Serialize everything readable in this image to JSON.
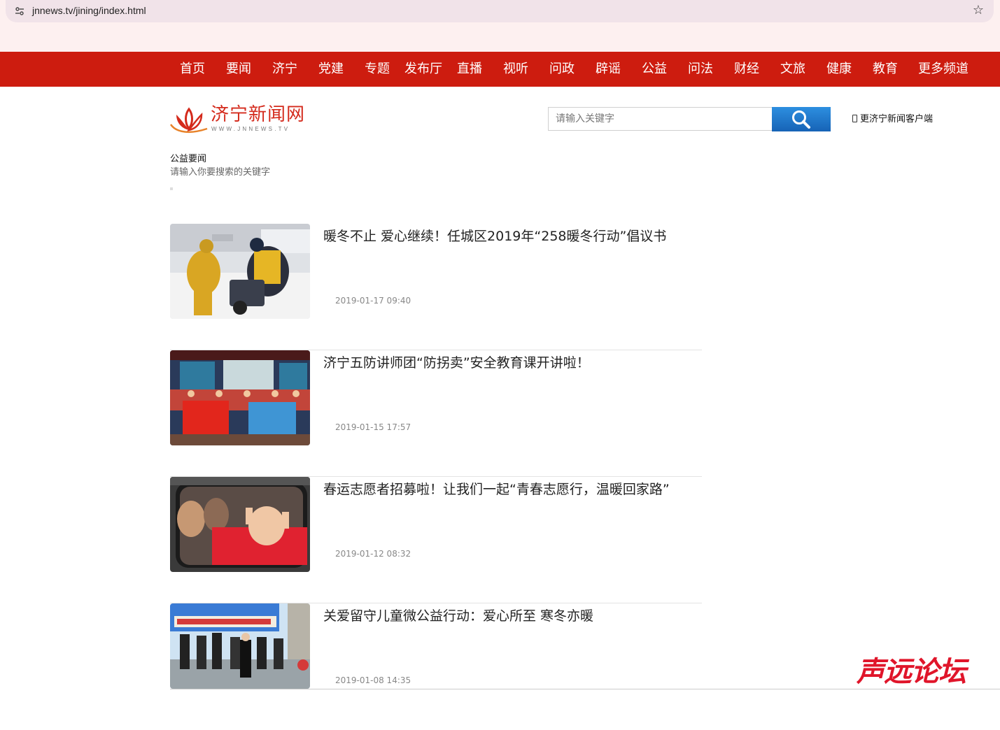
{
  "browser": {
    "url": "jnnews.tv/jining/index.html"
  },
  "nav": {
    "items": [
      "首页",
      "要闻",
      "济宁",
      "党建",
      "专题",
      "发布厅",
      "直播",
      "视听",
      "问政",
      "辟谣",
      "公益",
      "问法",
      "财经",
      "文旅",
      "健康",
      "教育",
      "更多频道"
    ]
  },
  "header": {
    "logo_text": "济宁新闻网",
    "logo_url": "WWW.JNNEWS.TV",
    "search_placeholder": "请输入关键字",
    "client_link": "更济宁新闻客户端"
  },
  "section": {
    "title": "公益要闻",
    "subtitle": "请输入你要搜索的关键字"
  },
  "news": [
    {
      "title": "暖冬不止 爱心继续！任城区2019年“258暖冬行动”倡议书",
      "date": "2019-01-17 09:40"
    },
    {
      "title": "济宁五防讲师团“防拐卖”安全教育课开讲啦！",
      "date": "2019-01-15 17:57"
    },
    {
      "title": "春运志愿者招募啦！让我们一起“青春志愿行，温暖回家路”",
      "date": "2019-01-12 08:32"
    },
    {
      "title": "关爱留守儿童微公益行动：爱心所至 寒冬亦暖",
      "date": "2019-01-08 14:35"
    }
  ],
  "watermark": "声远论坛",
  "colors": {
    "nav_bg": "#cd1c0f",
    "logo_red": "#d42a1c",
    "search_blue": "#1f7bd0"
  }
}
